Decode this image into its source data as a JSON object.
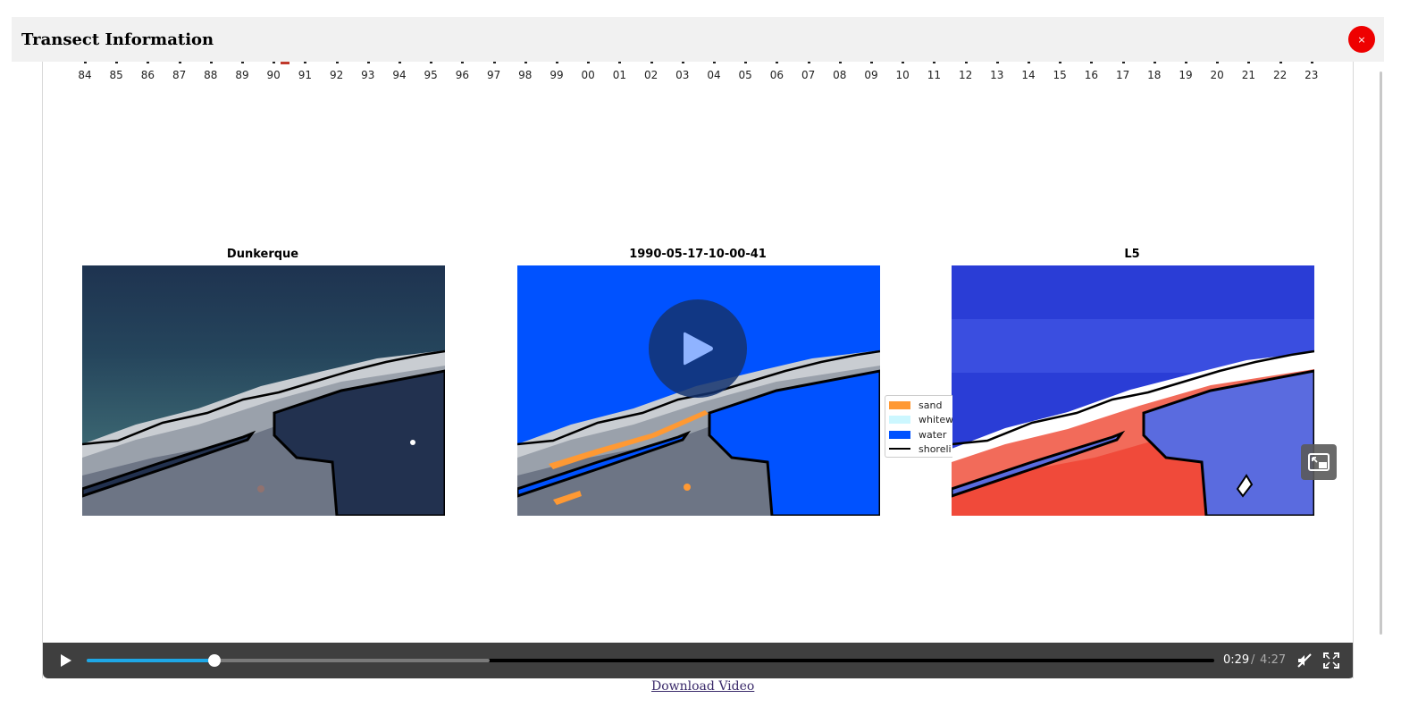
{
  "modal": {
    "title": "Transect Information",
    "close_glyph": "×"
  },
  "timeline": {
    "years": [
      "84",
      "85",
      "86",
      "87",
      "88",
      "89",
      "90",
      "91",
      "92",
      "93",
      "94",
      "95",
      "96",
      "97",
      "98",
      "99",
      "00",
      "01",
      "02",
      "03",
      "04",
      "05",
      "06",
      "07",
      "08",
      "09",
      "10",
      "11",
      "12",
      "13",
      "14",
      "15",
      "16",
      "17",
      "18",
      "19",
      "20",
      "21",
      "22",
      "23"
    ],
    "current_year": "90",
    "marker_color": "#c0392b"
  },
  "panels": {
    "left_title": "Dunkerque",
    "center_title": "1990-05-17-10-00-41",
    "right_title": "L5"
  },
  "legend": {
    "items": [
      {
        "label": "sand",
        "color": "#ff9933"
      },
      {
        "label": "whitew",
        "color": "#ccf7ff"
      },
      {
        "label": "water",
        "color": "#0052ff"
      },
      {
        "label": "shoreli",
        "color": "#000000"
      }
    ]
  },
  "player": {
    "time_current": "0:29",
    "time_separator": "/",
    "time_total": "4:27",
    "progress_fraction": 0.113,
    "buffered_fraction": 0.357,
    "accent_color": "#1ea7e6",
    "play_icon": "play-icon",
    "mute_icon": "mute-icon",
    "fullscreen_icon": "fullscreen-icon",
    "pip_icon": "picture-in-picture-icon"
  },
  "download": {
    "label": "Download Video"
  }
}
